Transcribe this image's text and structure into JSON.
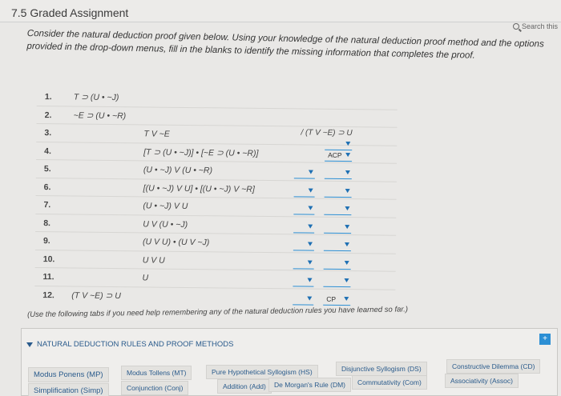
{
  "page": {
    "title": "7.5 Graded Assignment",
    "search_label": "Search this",
    "instructions": "Consider the natural deduction proof given below. Using your knowledge of the natural deduction proof method and the options provided in the drop-down menus, fill in the blanks to identify the missing information that completes the proof."
  },
  "proof": {
    "rows": [
      {
        "num": "1.",
        "statement": "T ⊃ (U • ~J)",
        "pos": "left"
      },
      {
        "num": "2.",
        "statement": "~E ⊃ (U • ~R)",
        "pos": "left"
      },
      {
        "num": "3.",
        "statement": "T V ~E",
        "pos": "mid",
        "extra": "/ (T V ~E) ⊃ U"
      },
      {
        "num": "4.",
        "statement": "[T ⊃ (U • ~J)] • [~E ⊃ (U • ~R)]",
        "pos": "mid"
      },
      {
        "num": "5.",
        "statement": "(U • ~J) V (U • ~R)",
        "pos": "mid"
      },
      {
        "num": "6.",
        "statement": "[(U • ~J) V U] • [(U • ~J) V ~R]",
        "pos": "mid"
      },
      {
        "num": "7.",
        "statement": "(U • ~J) V U",
        "pos": "mid"
      },
      {
        "num": "8.",
        "statement": "U V (U • ~J)",
        "pos": "mid"
      },
      {
        "num": "9.",
        "statement": "(U V U) • (U V ~J)",
        "pos": "mid"
      },
      {
        "num": "10.",
        "statement": "U V U",
        "pos": "mid"
      },
      {
        "num": "11.",
        "statement": "U",
        "pos": "mid"
      },
      {
        "num": "12.",
        "statement": "(T V ~E) ⊃ U",
        "pos": "left"
      }
    ],
    "dropdown_values": {
      "row3_b": "",
      "row4_b": "ACP",
      "row12_b": "CP"
    }
  },
  "note": "(Use the following tabs if you need help remembering any of the natural deduction rules you have learned so far.)",
  "panel": {
    "header": "NATURAL DEDUCTION RULES AND PROOF METHODS",
    "tabs": [
      "Modus Ponens (MP)",
      "Modus Tollens (MT)",
      "Pure Hypothetical Syllogism (HS)",
      "Disjunctive Syllogism (DS)",
      "Constructive Dilemma (CD)",
      "Simplification (Simp)",
      "Conjunction (Conj)",
      "Addition (Add)",
      "De Morgan's Rule (DM)",
      "Commutativity (Com)",
      "Associativity (Assoc)"
    ]
  }
}
